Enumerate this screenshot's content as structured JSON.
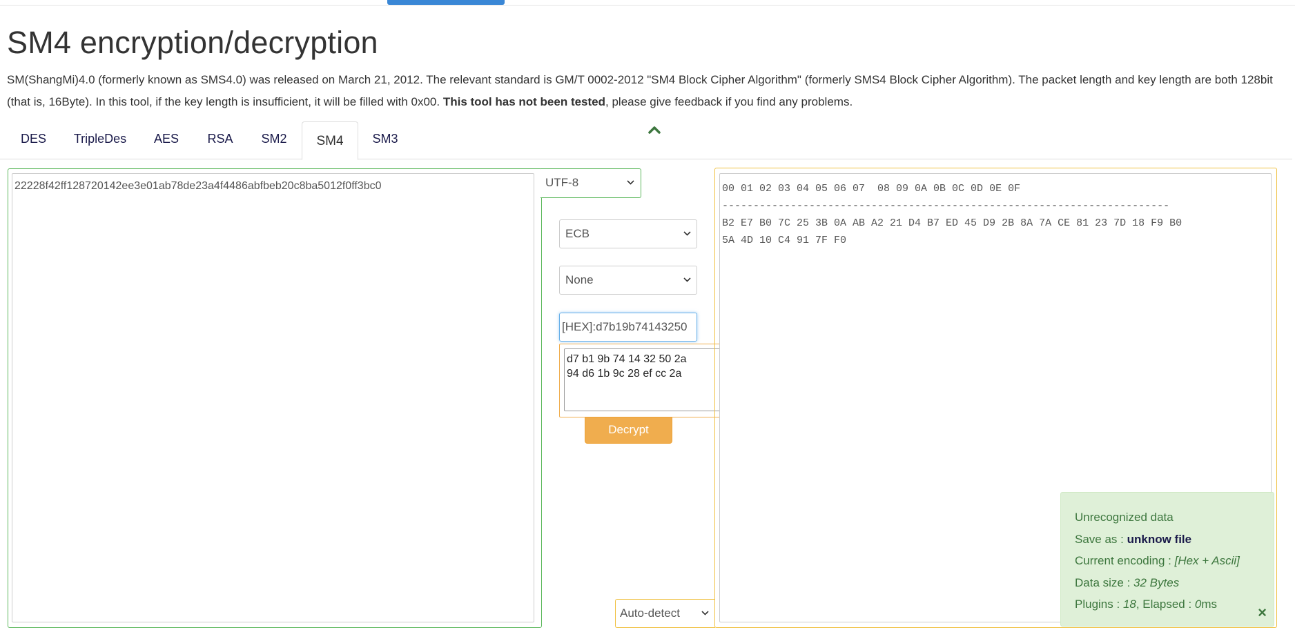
{
  "page": {
    "title": "SM4 encryption/decryption",
    "description_part1": "SM(ShangMi)4.0 (formerly known as SMS4.0) was released on March 21, 2012. The relevant standard is GM/T 0002-2012 \"SM4 Block Cipher Algorithm\" (formerly SMS4 Block Cipher Algorithm). The packet length and key length are both 128bit (that is, 16Byte). In this tool, if the key length is insufficient, it will be filled with 0x00. ",
    "description_bold": "This tool has not been tested",
    "description_part2": ", please give feedback if you find any problems."
  },
  "tabs": [
    {
      "label": "DES"
    },
    {
      "label": "TripleDes"
    },
    {
      "label": "AES"
    },
    {
      "label": "RSA"
    },
    {
      "label": "SM2"
    },
    {
      "label": "SM4",
      "active": true
    },
    {
      "label": "SM3"
    }
  ],
  "input": {
    "value": "22228f42ff128720142ee3e01ab78de23a4f4486abfbeb20c8ba5012f0ff3bc0",
    "encoding": "UTF-8"
  },
  "controls": {
    "mode": "ECB",
    "padding": "None",
    "key": "[HEX]:d7b19b74143250",
    "key_hex_lines": "d7 b1 9b 74 14 32 50 2a\n94 d6 1b 9c 28 ef cc 2a",
    "decrypt_label": "Decrypt"
  },
  "output": {
    "hex_header": "00 01 02 03 04 05 06 07  08 09 0A 0B 0C 0D 0E 0F",
    "hex_separator": "------------------------------------------------------------------------",
    "hex_line1": "B2 E7 B0 7C 25 3B 0A AB A2 21 D4 B7 ED 45 D9 2B 8A 7A CE 81 23 7D 18 F9 B0",
    "hex_line2": "5A 4D 10 C4 91 7F F0",
    "detect": "Auto-detect"
  },
  "info": {
    "status": "Unrecognized data",
    "save_as_label": "Save as : ",
    "save_as_value": "unknow file",
    "encoding_label": "Current encoding : ",
    "encoding_value": "[Hex + Ascii]",
    "size_label": "Data size : ",
    "size_value": "32 Bytes",
    "plugins_label": "Plugins : ",
    "plugins_value": "18",
    "elapsed_label": ",  Elapsed : ",
    "elapsed_value": "0",
    "elapsed_unit": "ms",
    "close": "×"
  },
  "colors": {
    "accent_blue": "#3a87d6",
    "green_border": "#5cb85c",
    "orange": "#f0ad4e",
    "yellow_border": "#f0c040",
    "info_bg": "#dff0d8",
    "info_text": "#3c763d"
  }
}
